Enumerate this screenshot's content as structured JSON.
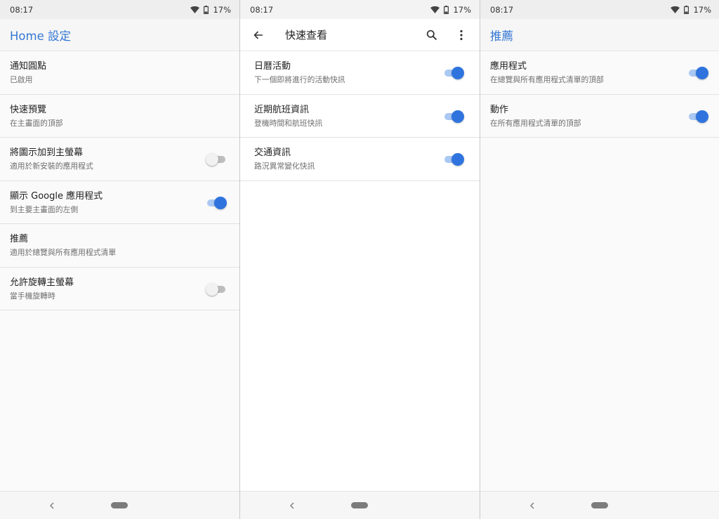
{
  "screens": [
    {
      "status": {
        "time": "08:17",
        "battery": "17%"
      },
      "title": "Home 設定",
      "items": [
        {
          "title": "通知圓點",
          "subtitle": "已啟用"
        },
        {
          "title": "快速預覽",
          "subtitle": "在主畫面的頂部"
        },
        {
          "title": "將圖示加到主螢幕",
          "subtitle": "適用於新安裝的應用程式",
          "toggle": "off"
        },
        {
          "title": "顯示 Google 應用程式",
          "subtitle": "到主要主畫面的左側",
          "toggle": "on"
        },
        {
          "title": "推薦",
          "subtitle": "適用於總覽與所有應用程式清單"
        },
        {
          "title": "允許旋轉主螢幕",
          "subtitle": "當手機旋轉時",
          "toggle": "off"
        }
      ]
    },
    {
      "status": {
        "time": "08:17",
        "battery": "17%"
      },
      "title": "快速查看",
      "icons": {
        "back": "arrow-back-icon",
        "search": "search-icon",
        "more": "more-vert-icon"
      },
      "items": [
        {
          "title": "日曆活動",
          "subtitle": "下一個即將進行的活動快訊",
          "toggle": "on"
        },
        {
          "title": "近期航班資訊",
          "subtitle": "登機時間和航班快訊",
          "toggle": "on"
        },
        {
          "title": "交通資訊",
          "subtitle": "路況異常變化快訊",
          "toggle": "on"
        }
      ]
    },
    {
      "status": {
        "time": "08:17",
        "battery": "17%"
      },
      "title": "推薦",
      "items": [
        {
          "title": "應用程式",
          "subtitle": "在總覽與所有應用程式清單的頂部",
          "toggle": "on"
        },
        {
          "title": "動作",
          "subtitle": "在所有應用程式清單的頂部",
          "toggle": "on"
        }
      ]
    }
  ],
  "colors": {
    "accent": "#2f74de",
    "title_blue": "#3478d4",
    "track_on": "#a9c8f3",
    "track_off": "#bdbdbd"
  }
}
